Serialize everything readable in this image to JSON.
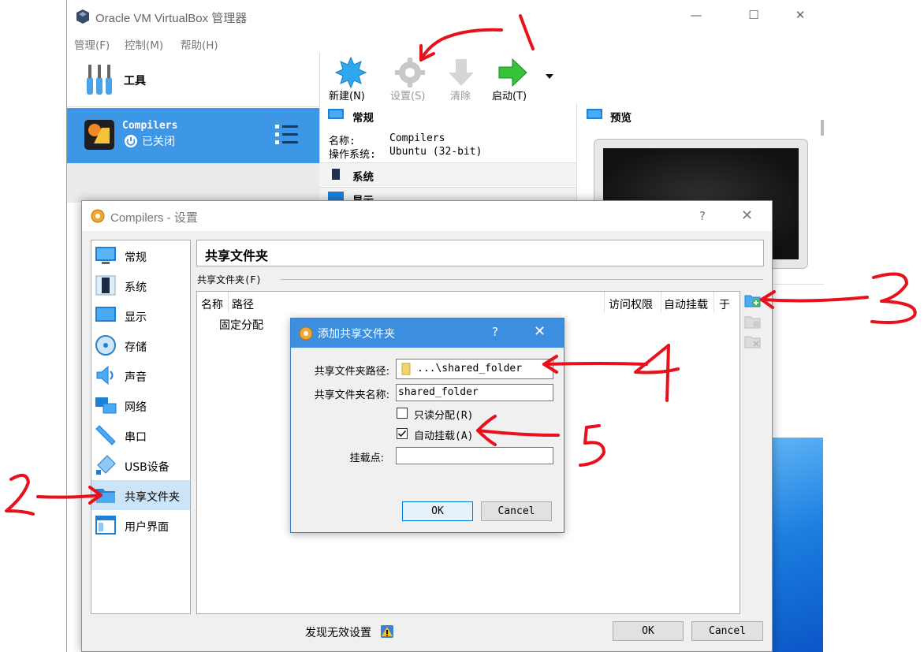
{
  "manager": {
    "title": "Oracle VM VirtualBox 管理器",
    "window_controls": {
      "minimize": "—",
      "maximize": "☐",
      "close": "✕"
    },
    "menu": [
      "管理(F)",
      "控制(M)",
      "帮助(H)"
    ],
    "tools_label": "工具",
    "vm": {
      "name": "Compilers",
      "state": "已关闭"
    },
    "toolbar": [
      {
        "label": "新建(N)",
        "icon": "new-sun-icon"
      },
      {
        "label": "设置(S)",
        "icon": "gear-icon"
      },
      {
        "label": "清除",
        "icon": "discard-arrow-icon"
      },
      {
        "label": "启动(T)",
        "icon": "start-arrow-icon"
      }
    ],
    "details": {
      "general_header": "常规",
      "name_label": "名称:",
      "name_value": "Compilers",
      "os_label": "操作系统:",
      "os_value": "Ubuntu (32-bit)",
      "system_header": "系统",
      "display_header": "显示"
    },
    "preview_header": "预览"
  },
  "settings": {
    "title": "Compilers - 设置",
    "help": "?",
    "close": "✕",
    "categories": [
      {
        "label": "常规",
        "icon": "monitor-icon"
      },
      {
        "label": "系统",
        "icon": "chip-icon"
      },
      {
        "label": "显示",
        "icon": "display-icon"
      },
      {
        "label": "存储",
        "icon": "disc-icon"
      },
      {
        "label": "声音",
        "icon": "speaker-icon"
      },
      {
        "label": "网络",
        "icon": "network-icon"
      },
      {
        "label": "串口",
        "icon": "serial-port-icon"
      },
      {
        "label": "USB设备",
        "icon": "usb-icon"
      },
      {
        "label": "共享文件夹",
        "icon": "folder-icon"
      },
      {
        "label": "用户界面",
        "icon": "window-icon"
      }
    ],
    "selected_category": "共享文件夹",
    "page_title": "共享文件夹",
    "group_label": "共享文件夹(F)",
    "table_headers": [
      "名称",
      "路径",
      "访问权限",
      "自动挂载",
      "于"
    ],
    "table_rows": [
      "固定分配"
    ],
    "invalid_settings": "发现无效设置",
    "ok": "OK",
    "cancel": "Cancel"
  },
  "add_folder": {
    "title": "添加共享文件夹",
    "help": "?",
    "close": "✕",
    "path_label": "共享文件夹路径:",
    "path_value": "...\\shared_folder",
    "name_label": "共享文件夹名称:",
    "name_value": "shared_folder",
    "readonly_label": "只读分配(R)",
    "readonly_checked": false,
    "automount_label": "自动挂载(A)",
    "automount_checked": true,
    "mountpoint_label": "挂载点:",
    "mountpoint_value": "",
    "ok": "OK",
    "cancel": "Cancel"
  },
  "annotations": {
    "n1": "1",
    "n2": "2",
    "n3": "3",
    "n4": "4",
    "n5": "5",
    "color": "#e8101a"
  }
}
